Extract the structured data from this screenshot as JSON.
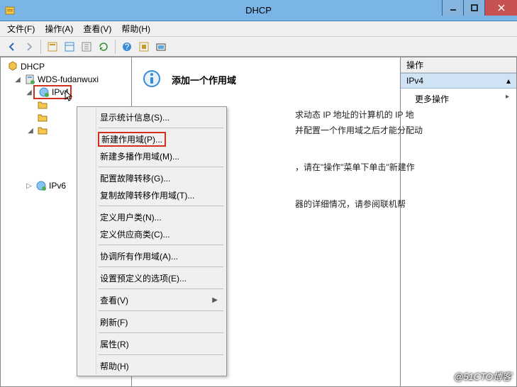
{
  "window": {
    "title": "DHCP"
  },
  "menu": {
    "file": "文件(F)",
    "action": "操作(A)",
    "view": "查看(V)",
    "help": "帮助(H)"
  },
  "tree": {
    "root": "DHCP",
    "server": "WDS-fudanwuxi",
    "ipv4": "IPv4",
    "ipv6": "IPv6"
  },
  "content": {
    "heading": "添加一个作用域",
    "line1": "求动态 IP 地址的计算机的 IP 地",
    "line2": "并配置一个作用域之后才能分配动",
    "line3_a": "，请在\"操作\"菜单下单击\"新建作",
    "line4_a": "器的详细情况，请参阅联机帮"
  },
  "actions": {
    "header": "操作",
    "sub": "IPv4",
    "more": "更多操作"
  },
  "context_menu": {
    "stats": "显示统计信息(S)...",
    "new_scope": "新建作用域(P)...",
    "new_multicast": "新建多播作用域(M)...",
    "config_failover": "配置故障转移(G)...",
    "replicate_failover": "复制故障转移作用域(T)...",
    "user_class": "定义用户类(N)...",
    "vendor_class": "定义供应商类(C)...",
    "reconcile": "协调所有作用域(A)...",
    "set_options": "设置预定义的选项(E)...",
    "view": "查看(V)",
    "refresh": "刷新(F)",
    "properties": "属性(R)",
    "help": "帮助(H)"
  },
  "watermark": "@51CTO博客"
}
